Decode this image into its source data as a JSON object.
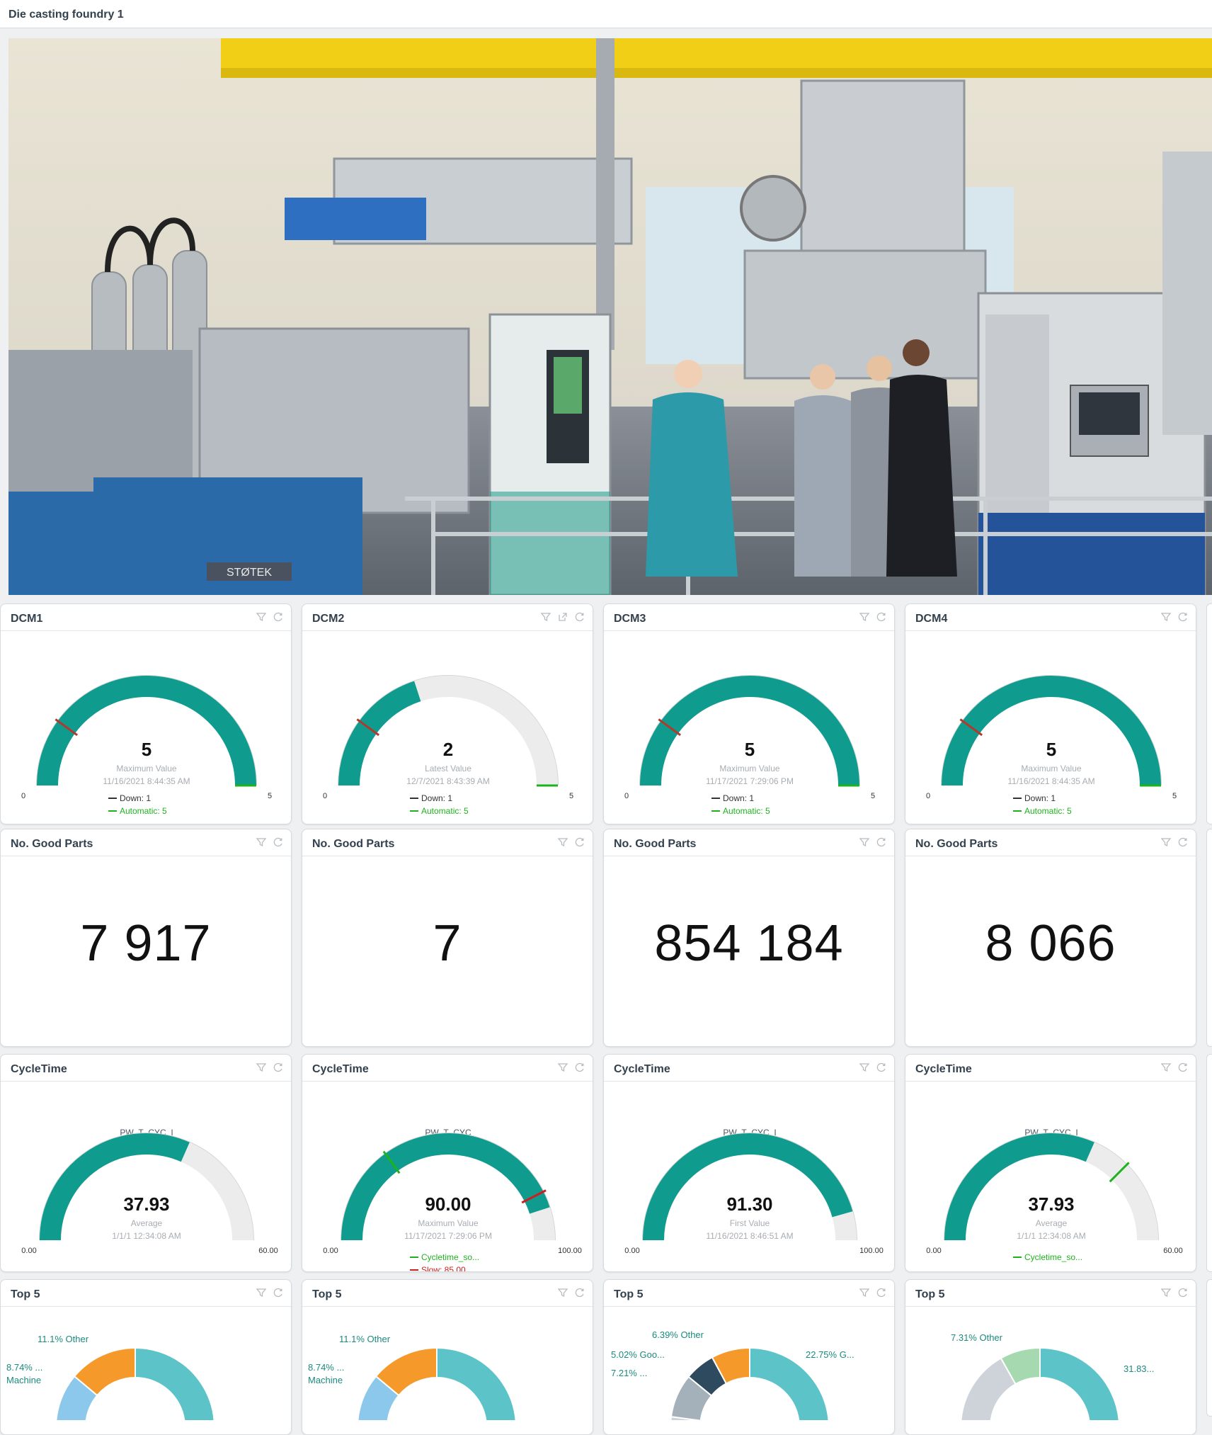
{
  "page": {
    "title": "Die casting foundry 1"
  },
  "hero": {
    "image": "industrial-photo"
  },
  "colors": {
    "teal": "#0f9b8e",
    "gray": "#e9e9e9",
    "green": "#1db31d",
    "red": "#cc1f1f",
    "orange": "#f59a2a",
    "lightblue": "#8cc7ec",
    "cyan": "#5cc3c8",
    "lightgreen": "#a7d9b1",
    "darkslate": "#2e4a5e",
    "slate": "#a4b1bb",
    "silver": "#cdd3d8"
  },
  "dcm_cards": [
    {
      "title": "DCM1",
      "var": "svBAbetriebsart",
      "value": "5",
      "label": "Maximum Value",
      "date": "11/16/2021 8:44:35 AM",
      "min": "0",
      "max": "5",
      "fraction": 1.0,
      "marker_fraction": 0.2,
      "legend": [
        {
          "text": "Down: 1",
          "color": "#333333"
        },
        {
          "text": "Automatic: 5",
          "color": "#1db31d"
        }
      ]
    },
    {
      "title": "DCM2",
      "var": "svBAbetriebsart",
      "value": "2",
      "label": "Latest Value",
      "date": "12/7/2021 8:43:39 AM",
      "min": "0",
      "max": "5",
      "fraction": 0.4,
      "marker_fraction": 0.2,
      "legend": [
        {
          "text": "Down: 1",
          "color": "#333333"
        },
        {
          "text": "Automatic: 5",
          "color": "#1db31d"
        }
      ]
    },
    {
      "title": "DCM3",
      "var": "svBAbetriebsart",
      "value": "5",
      "label": "Maximum Value",
      "date": "11/17/2021 7:29:06 PM",
      "min": "0",
      "max": "5",
      "fraction": 1.0,
      "marker_fraction": 0.2,
      "legend": [
        {
          "text": "Down: 1",
          "color": "#333333"
        },
        {
          "text": "Automatic: 5",
          "color": "#1db31d"
        }
      ]
    },
    {
      "title": "DCM4",
      "var": "svBAbetriebsart",
      "value": "5",
      "label": "Maximum Value",
      "date": "11/16/2021 8:44:35 AM",
      "min": "0",
      "max": "5",
      "fraction": 1.0,
      "marker_fraction": 0.2,
      "legend": [
        {
          "text": "Down: 1",
          "color": "#333333"
        },
        {
          "text": "Automatic: 5",
          "color": "#1db31d"
        }
      ]
    }
  ],
  "good_parts_cards": [
    {
      "title": "No. Good Parts",
      "value": "7 917"
    },
    {
      "title": "No. Good Parts",
      "value": "7"
    },
    {
      "title": "No. Good Parts",
      "value": "854 184"
    },
    {
      "title": "No. Good Parts",
      "value": "8 066"
    }
  ],
  "cycle_cards": [
    {
      "title": "CycleTime",
      "var": "PW_T_CYC_I",
      "value": "37.93",
      "label": "Average",
      "date": "1/1/1 12:34:08 AM",
      "min": "0.00",
      "max": "60.00",
      "fraction": 0.632,
      "markers": [],
      "legend": []
    },
    {
      "title": "CycleTime",
      "var": "PW_T_CYC",
      "value": "90.00",
      "label": "Maximum Value",
      "date": "11/17/2021 7:29:06 PM",
      "min": "0.00",
      "max": "100.00",
      "fraction": 0.9,
      "markers": [
        {
          "fraction": 0.3,
          "color": "#1db31d"
        },
        {
          "fraction": 0.85,
          "color": "#cc1f1f"
        }
      ],
      "legend": [
        {
          "text": "Cycletime_so...",
          "color": "#1db31d"
        },
        {
          "text": "Slow: 85.00",
          "color": "#cc1f1f"
        }
      ]
    },
    {
      "title": "CycleTime",
      "var": "PW_T_CYC_I",
      "value": "91.30",
      "label": "First Value",
      "date": "11/16/2021 8:46:51 AM",
      "min": "0.00",
      "max": "100.00",
      "fraction": 0.913,
      "markers": [],
      "legend": []
    },
    {
      "title": "CycleTime",
      "var": "PW_T_CYC_I",
      "value": "37.93",
      "label": "Average",
      "date": "1/1/1 12:34:08 AM",
      "min": "0.00",
      "max": "60.00",
      "fraction": 0.632,
      "markers": [
        {
          "fraction": 0.75,
          "color": "#1db31d"
        }
      ],
      "legend": [
        {
          "text": "Cycletime_so...",
          "color": "#1db31d"
        }
      ]
    }
  ],
  "top5_cards": [
    {
      "title": "Top 5",
      "labels": [
        "11.1% Other",
        "8.74% ...",
        "Machine"
      ]
    },
    {
      "title": "Top 5",
      "labels": [
        "11.1% Other",
        "8.74% ...",
        "Machine"
      ]
    },
    {
      "title": "Top 5",
      "labels": [
        "6.39% Other",
        "5.02% Goo...",
        "7.21% ...",
        "22.75% G..."
      ]
    },
    {
      "title": "Top 5",
      "labels": [
        "7.31% Other",
        "31.83..."
      ]
    }
  ],
  "chart_data": [
    {
      "type": "pie",
      "title": "Top 5",
      "slices": [
        {
          "label": "",
          "value": 50
        },
        {
          "label": "",
          "value": 10
        },
        {
          "label": "Machine",
          "value": 8.74
        },
        {
          "label": "Other",
          "value": 11.1
        }
      ]
    },
    {
      "type": "pie",
      "title": "Top 5",
      "slices": [
        {
          "label": "",
          "value": 50
        },
        {
          "label": "",
          "value": 10
        },
        {
          "label": "Machine",
          "value": 8.74
        },
        {
          "label": "Other",
          "value": 11.1
        }
      ]
    },
    {
      "type": "pie",
      "title": "Top 5",
      "slices": [
        {
          "label": "G...",
          "value": 22.75
        },
        {
          "label": "",
          "value": 10
        },
        {
          "label": "",
          "value": 30
        },
        {
          "label": "",
          "value": 7.21
        },
        {
          "label": "Goo...",
          "value": 5.02
        },
        {
          "label": "Other",
          "value": 6.39
        }
      ]
    },
    {
      "type": "pie",
      "title": "Top 5",
      "slices": [
        {
          "label": "",
          "value": 31.83
        },
        {
          "label": "",
          "value": 50
        },
        {
          "label": "Other",
          "value": 7.31
        }
      ]
    }
  ]
}
